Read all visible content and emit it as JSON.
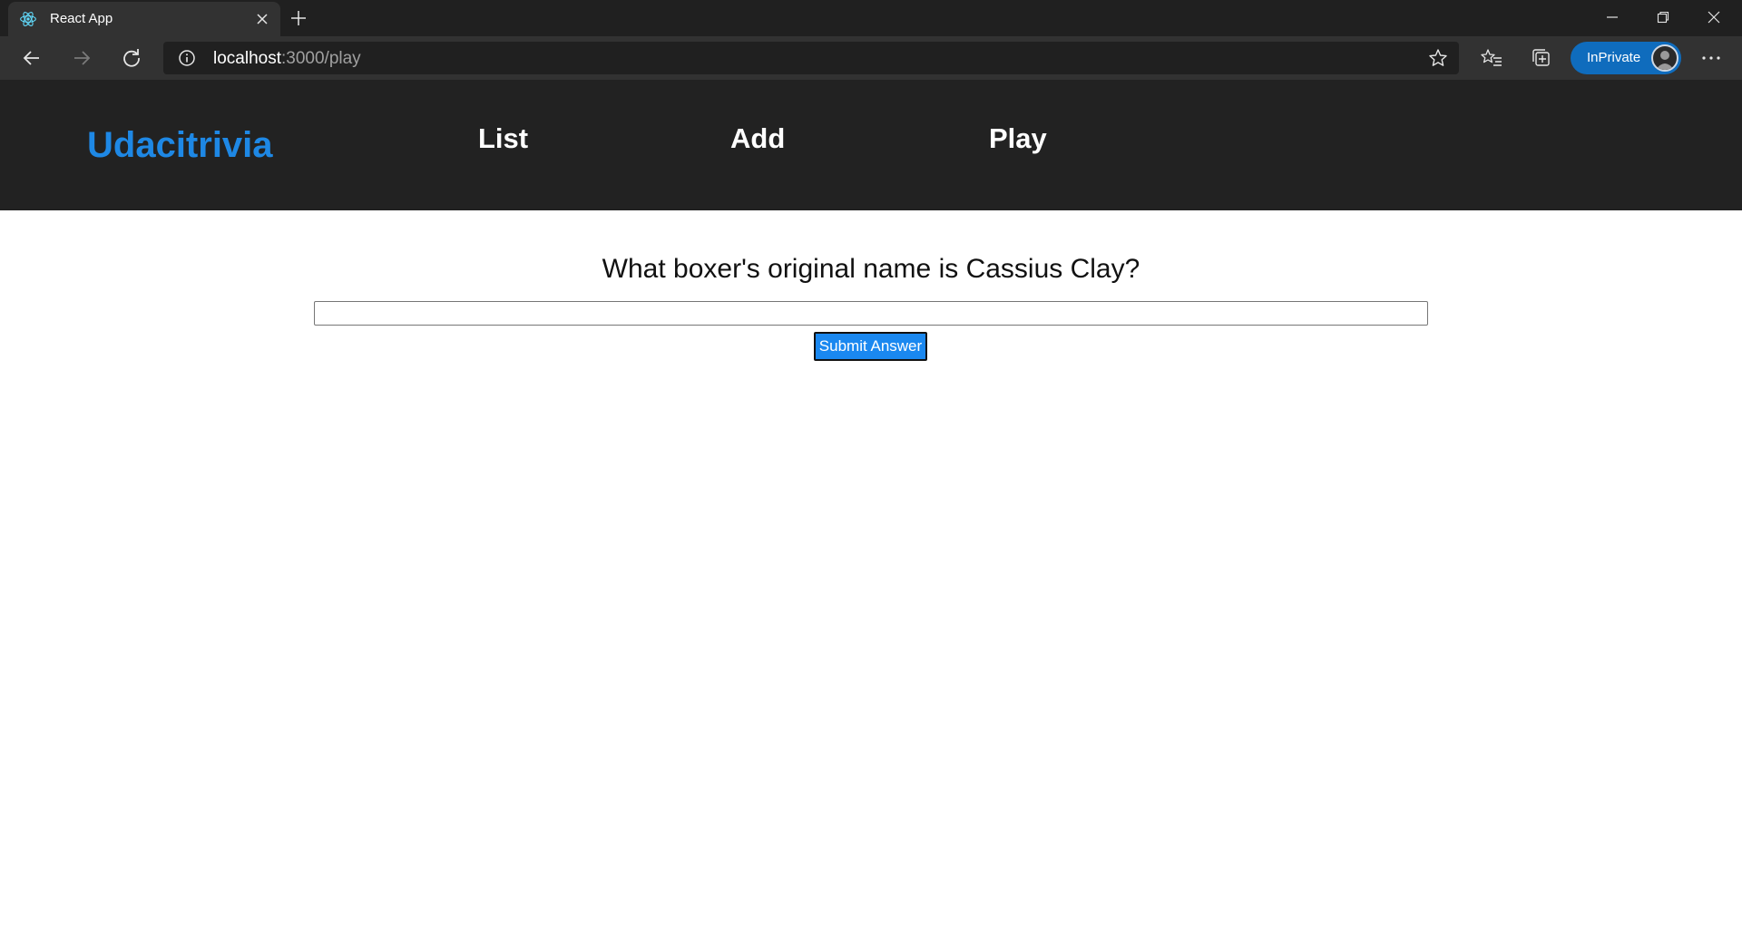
{
  "browser": {
    "tab": {
      "title": "React App",
      "favicon": "react-logo-icon"
    },
    "address": {
      "host": "localhost",
      "rest": ":3000/play"
    },
    "inprivate_label": "InPrivate",
    "icons": {
      "back": "back-arrow-icon",
      "forward": "forward-arrow-icon",
      "refresh": "refresh-icon",
      "info": "info-icon",
      "favorite": "star-icon",
      "favorites": "favorites-icon",
      "collections": "collections-icon",
      "more": "more-icon"
    }
  },
  "app": {
    "brand": "Udacitrivia",
    "nav": [
      {
        "label": "List"
      },
      {
        "label": "Add"
      },
      {
        "label": "Play"
      }
    ],
    "question": "What boxer's original name is Cassius Clay?",
    "answer_value": "",
    "submit_label": "Submit Answer"
  },
  "colors": {
    "brand": "#1e88e5",
    "nav_bg": "#222222",
    "submit_bg": "#1a88f0",
    "inprivate_bg": "#0f6cbd"
  }
}
